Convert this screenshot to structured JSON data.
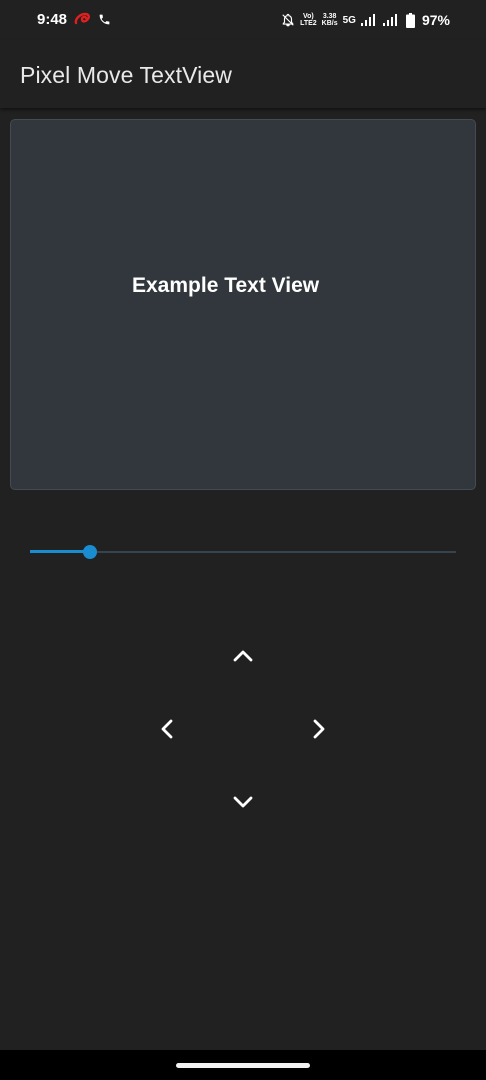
{
  "status_bar": {
    "time": "9:48",
    "network_line1": "Vo)",
    "network_line2": "LTE2",
    "speed_value": "3.38",
    "speed_unit": "KB/s",
    "network_type": "5G",
    "battery": "97%",
    "icons": [
      "airtel-logo-icon",
      "phone-call-icon",
      "bell-muted-icon",
      "signal-icon",
      "signal-icon",
      "battery-icon"
    ]
  },
  "app_bar": {
    "title": "Pixel Move TextView"
  },
  "text_view": {
    "text": "Example Text View"
  },
  "slider": {
    "value_fraction": 0.14,
    "accent_color": "#1a8cd0"
  },
  "dpad": {
    "icons": [
      "chevron-up-icon",
      "chevron-left-icon",
      "chevron-right-icon",
      "chevron-down-icon"
    ]
  },
  "colors": {
    "background": "#212121",
    "card": "#32373d",
    "accent": "#1a8cd0"
  }
}
